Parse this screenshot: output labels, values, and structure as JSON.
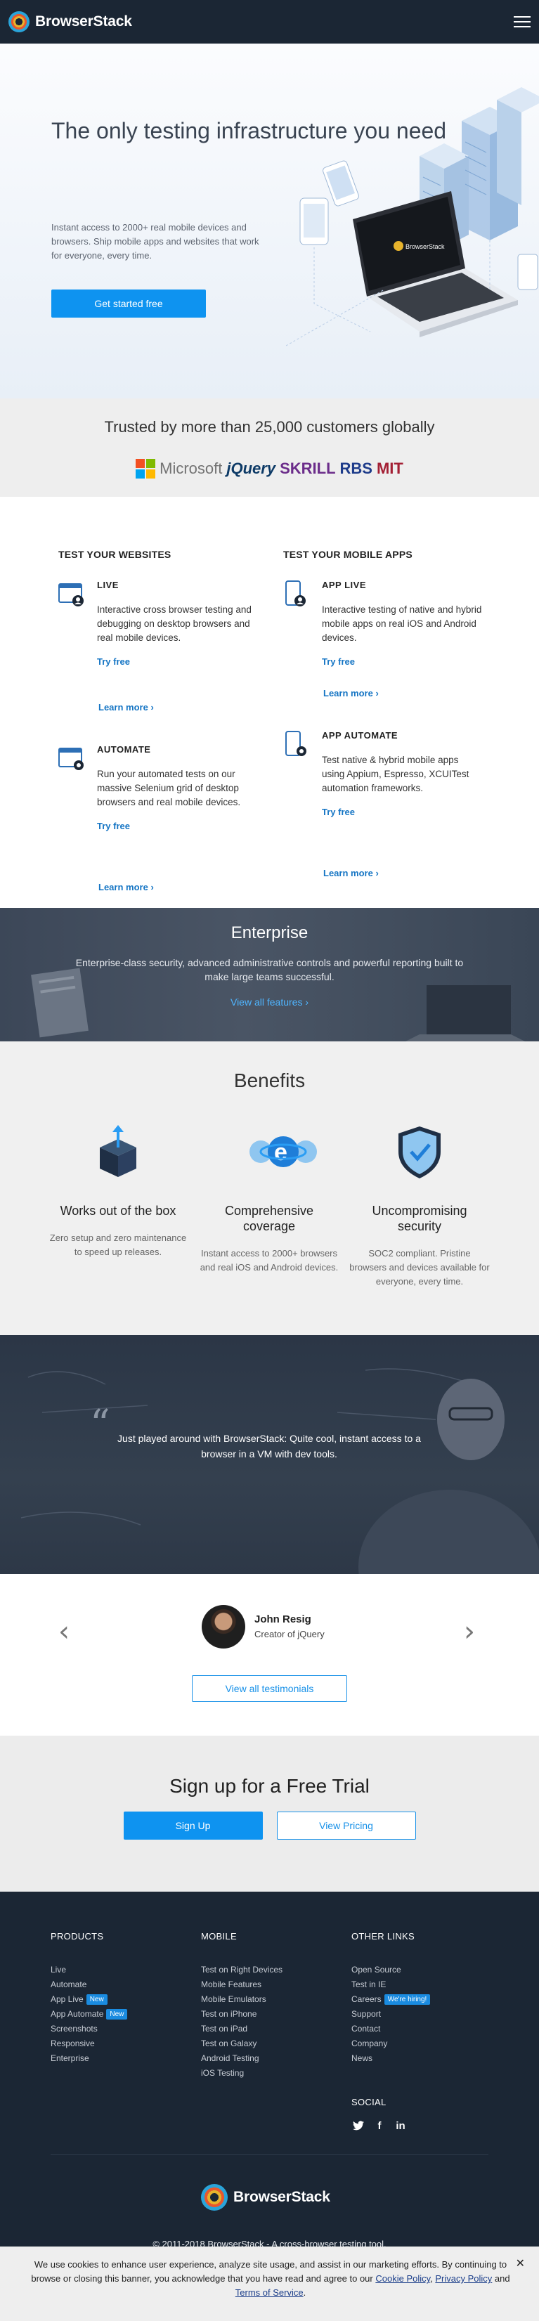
{
  "header": {
    "brand_name": "BrowserStack"
  },
  "hero": {
    "title": "The only testing infrastructure you need",
    "subtitle": "Instant access to 2000+ real mobile devices and browsers. Ship mobile apps and websites that work for everyone, every time.",
    "cta_label": "Get started free"
  },
  "trusted": {
    "heading": "Trusted by more than 25,000 customers globally",
    "logos": [
      "Microsoft",
      "jQuery",
      "SKRILL",
      "RBS",
      "MIT"
    ]
  },
  "features": {
    "websites": {
      "title": "TEST YOUR WEBSITES",
      "items": [
        {
          "name": "LIVE",
          "desc": "Interactive cross browser testing and debugging on desktop browsers and real mobile devices.",
          "try": "Try free",
          "more": "Learn more"
        },
        {
          "name": "AUTOMATE",
          "desc": "Run your automated tests on our massive Selenium grid of desktop browsers and real mobile devices.",
          "try": "Try free",
          "more": "Learn more"
        }
      ]
    },
    "mobile": {
      "title": "TEST YOUR MOBILE APPS",
      "items": [
        {
          "name": "APP LIVE",
          "desc": "Interactive testing of native and hybrid mobile apps on real iOS and Android devices.",
          "try": "Try free",
          "more": "Learn more"
        },
        {
          "name": "APP AUTOMATE",
          "desc": "Test native & hybrid mobile apps using Appium, Espresso, XCUITest automation frameworks.",
          "try": "Try free",
          "more": "Learn more"
        }
      ]
    }
  },
  "enterprise": {
    "title": "Enterprise",
    "desc": "Enterprise-class security, advanced administrative controls and powerful reporting built to make large teams successful.",
    "link": "View all features"
  },
  "benefits": {
    "title": "Benefits",
    "items": [
      {
        "title": "Works out of the box",
        "desc": "Zero setup and zero maintenance to speed up releases."
      },
      {
        "title": "Comprehensive coverage",
        "desc": "Instant access to 2000+ browsers and real iOS and Android devices."
      },
      {
        "title": "Uncompromising security",
        "desc": "SOC2 compliant. Pristine browsers and devices available for everyone, every time."
      }
    ]
  },
  "testimonial": {
    "quote": "Just played around with BrowserStack: Quite cool, instant access to a browser in a VM with dev tools.",
    "name": "John Resig",
    "role": "Creator of jQuery",
    "cta": "View all testimonials"
  },
  "signup": {
    "title": "Sign up for a Free Trial",
    "signup_label": "Sign Up",
    "pricing_label": "View Pricing"
  },
  "footer": {
    "products": {
      "title": "PRODUCTS",
      "items": [
        "Live",
        "Automate",
        "App Live",
        "App Automate",
        "Screenshots",
        "Responsive",
        "Enterprise"
      ],
      "new_tag": "New"
    },
    "mobile": {
      "title": "MOBILE",
      "items": [
        "Test on Right Devices",
        "Mobile Features",
        "Mobile Emulators",
        "Test on iPhone",
        "Test on iPad",
        "Test on Galaxy",
        "Android Testing",
        "iOS Testing"
      ]
    },
    "other": {
      "title": "OTHER LINKS",
      "items": [
        "Open Source",
        "Test in IE",
        "Careers",
        "Support",
        "Contact",
        "Company",
        "News"
      ],
      "hiring_tag": "We're hiring!"
    },
    "social": {
      "title": "SOCIAL",
      "icons": [
        "twitter-icon",
        "facebook-icon",
        "linkedin-icon"
      ]
    },
    "brand_name": "BrowserStack",
    "copyright": "© 2011-2018 BrowserStack - A cross-browser testing tool."
  },
  "cookie": {
    "text_before": "We use cookies to enhance user experience, analyze site usage, and assist in our marketing efforts. By continuing to browse or closing this banner, you acknowledge that you have read and agree to our ",
    "cookie_policy": "Cookie Policy",
    "sep1": ", ",
    "privacy_policy": "Privacy Policy",
    "sep2": " and ",
    "terms": "Terms of Service",
    "end": "."
  },
  "colors": {
    "header_bg": "#1b2634",
    "primary": "#0e93f0",
    "link": "#1575c4"
  }
}
